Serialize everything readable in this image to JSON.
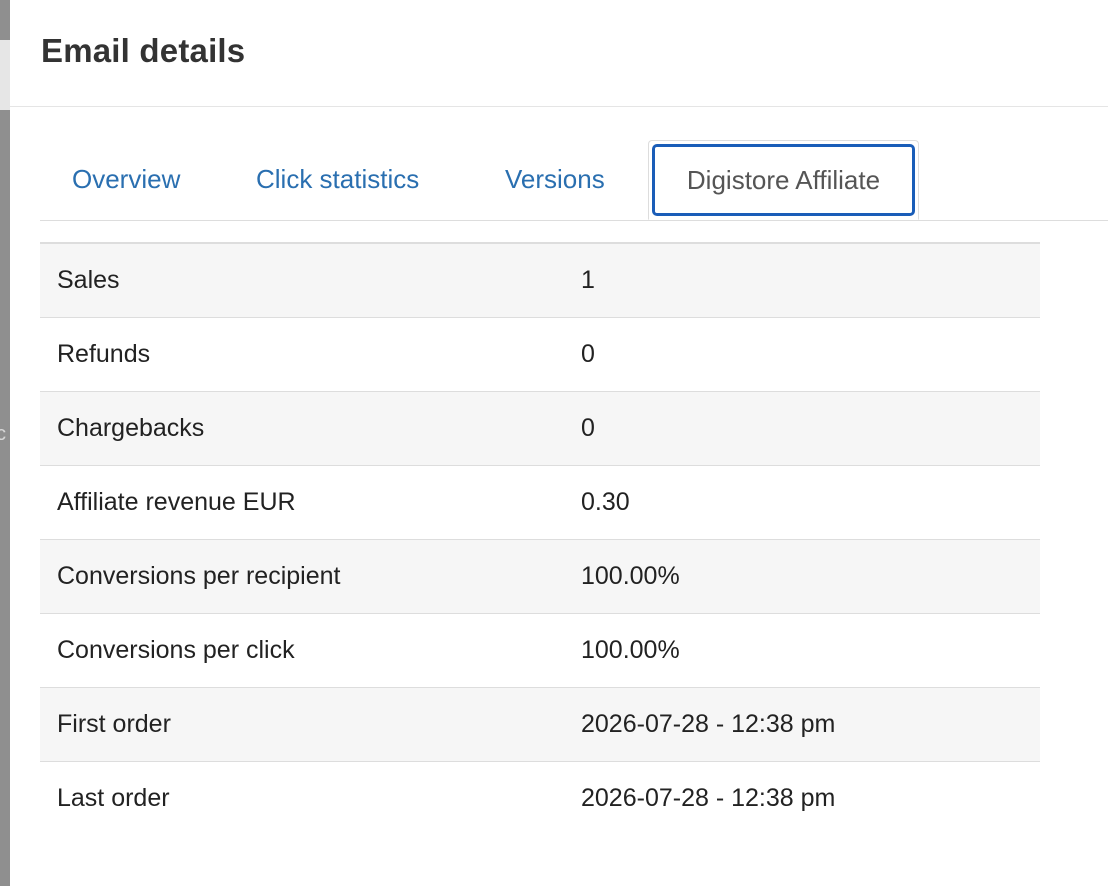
{
  "modal": {
    "title": "Email details"
  },
  "tabs": [
    {
      "label": "Overview",
      "active": false
    },
    {
      "label": "Click statistics",
      "active": false
    },
    {
      "label": "Versions",
      "active": false
    },
    {
      "label": "Digistore Affiliate",
      "active": true
    }
  ],
  "stats": {
    "rows": [
      {
        "label": "Sales",
        "value": "1"
      },
      {
        "label": "Refunds",
        "value": "0"
      },
      {
        "label": "Chargebacks",
        "value": "0"
      },
      {
        "label": "Affiliate revenue EUR",
        "value": "0.30"
      },
      {
        "label": "Conversions per recipient",
        "value": "100.00%"
      },
      {
        "label": "Conversions per click",
        "value": "100.00%"
      },
      {
        "label": "First order",
        "value": "2026-07-28 - 12:38 pm"
      },
      {
        "label": "Last order",
        "value": "2026-07-28 - 12:38 pm"
      }
    ]
  },
  "colors": {
    "link": "#2a6fb0",
    "active_tab_focus": "#1a5db8",
    "stripe": "#f6f6f6"
  }
}
